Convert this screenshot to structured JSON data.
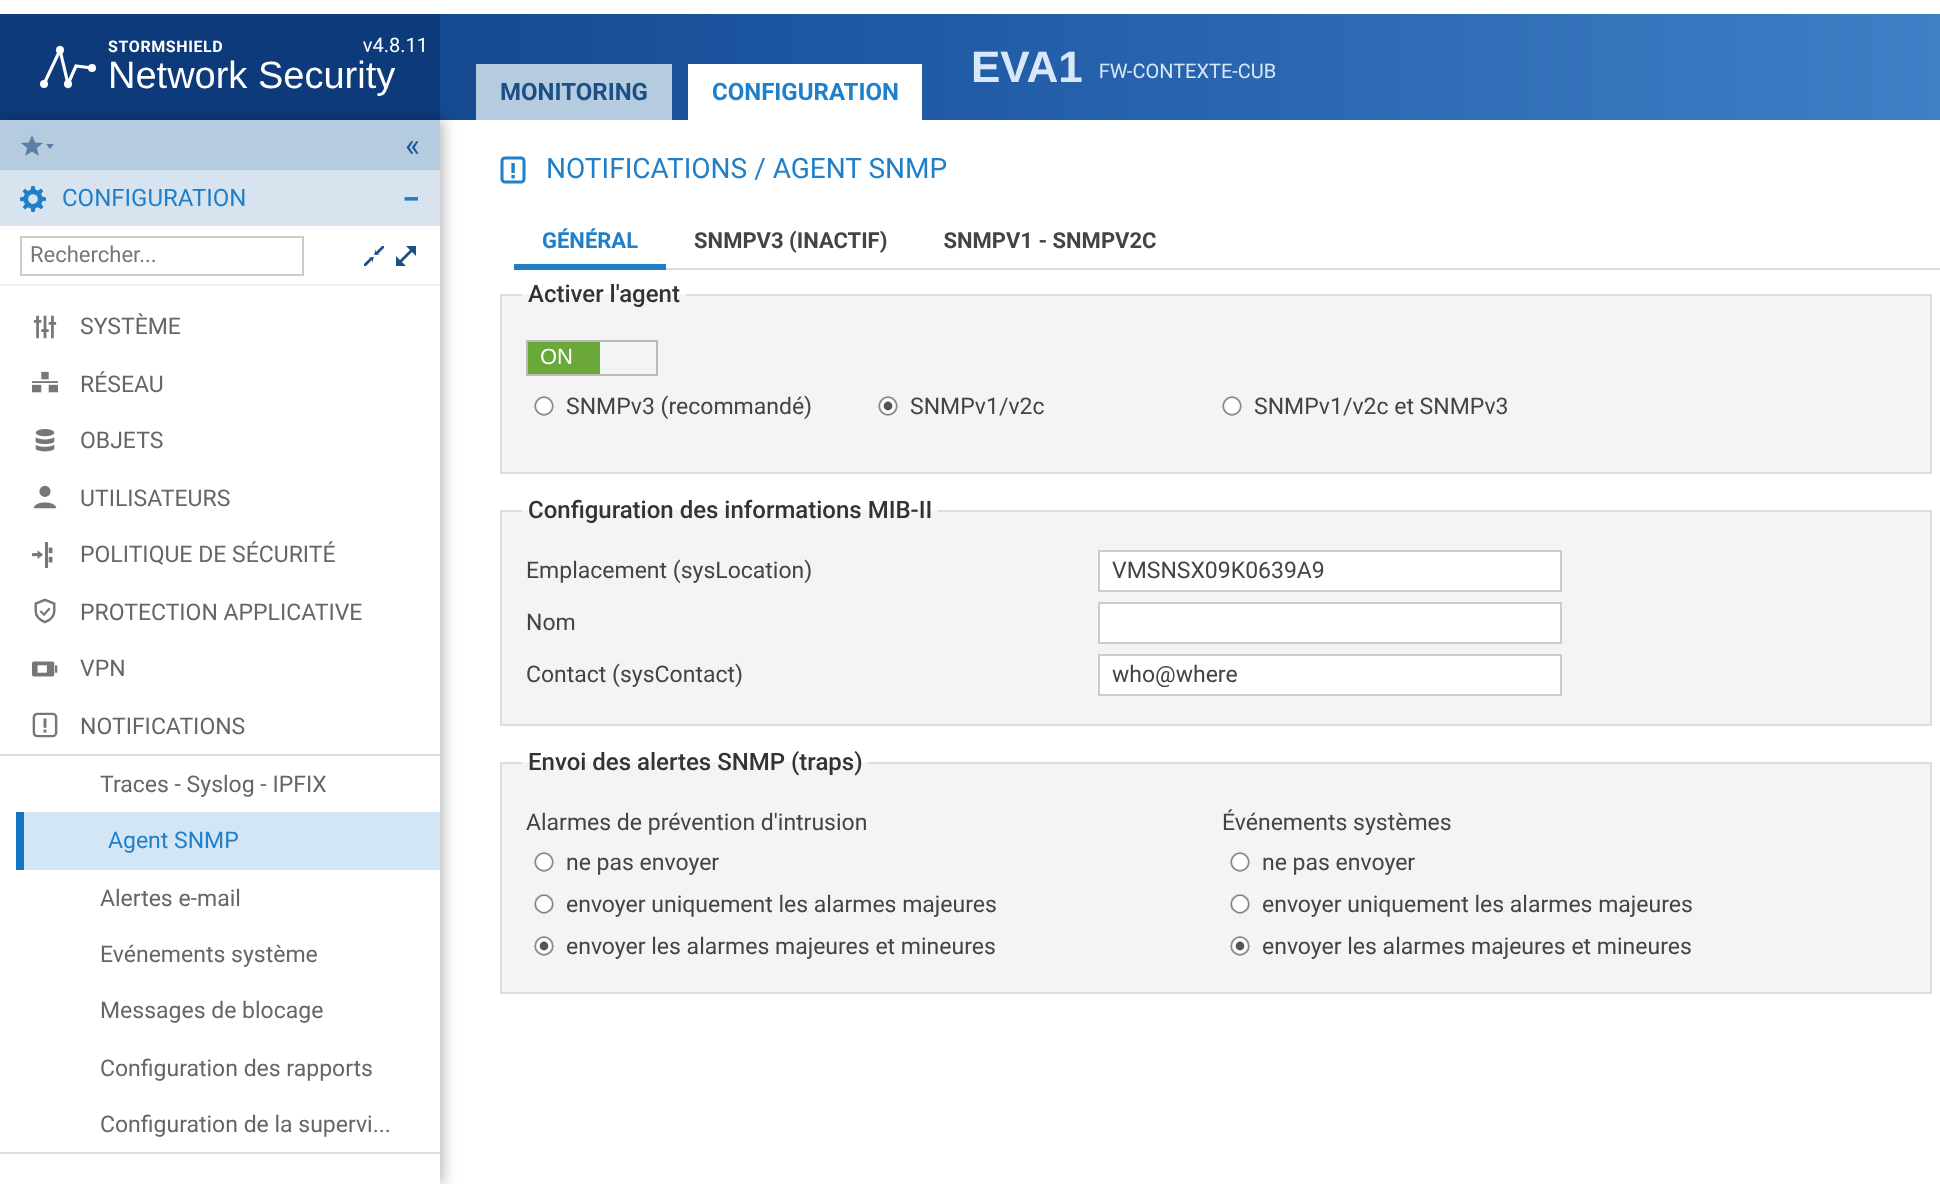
{
  "header": {
    "brand": "STORMSHIELD",
    "product": "Network Security",
    "version": "v4.8.11",
    "tabs": [
      {
        "label": "MONITORING",
        "selected": false
      },
      {
        "label": "CONFIGURATION",
        "selected": true
      }
    ],
    "device": "EVA1",
    "context": "FW-CONTEXTE-CUB"
  },
  "sidebar": {
    "section": {
      "label": "CONFIGURATION",
      "expanded": true,
      "toggle": "−"
    },
    "collapse": "«",
    "search": {
      "placeholder": "Rechercher..."
    },
    "items": [
      {
        "label": "SYSTÈME"
      },
      {
        "label": "RÉSEAU"
      },
      {
        "label": "OBJETS"
      },
      {
        "label": "UTILISATEURS"
      },
      {
        "label": "POLITIQUE DE SÉCURITÉ"
      },
      {
        "label": "PROTECTION APPLICATIVE"
      },
      {
        "label": "VPN"
      },
      {
        "label": "NOTIFICATIONS",
        "children": [
          {
            "label": "Traces - Syslog - IPFIX",
            "selected": false
          },
          {
            "label": "Agent SNMP",
            "selected": true
          },
          {
            "label": "Alertes e-mail",
            "selected": false
          },
          {
            "label": "Evénements système",
            "selected": false
          },
          {
            "label": "Messages de blocage",
            "selected": false
          },
          {
            "label": "Configuration des rapports",
            "selected": false
          },
          {
            "label": "Configuration de la supervi...",
            "selected": false
          }
        ]
      }
    ]
  },
  "main": {
    "title": "NOTIFICATIONS / AGENT SNMP",
    "tabs": [
      {
        "label": "GÉNÉRAL",
        "selected": true
      },
      {
        "label": "SNMPV3 (INACTIF)",
        "selected": false
      },
      {
        "label": "SNMPV1 - SNMPV2C",
        "selected": false
      }
    ],
    "sections": [
      {
        "kind": "agent",
        "legend": "Activer l'agent",
        "toggle": {
          "label": "ON",
          "on": true
        },
        "options": [
          {
            "label": "SNMPv3 (recommandé)",
            "selected": false
          },
          {
            "label": "SNMPv1/v2c",
            "selected": true
          },
          {
            "label": "SNMPv1/v2c et SNMPv3",
            "selected": false
          }
        ]
      },
      {
        "kind": "fields",
        "legend": "Configuration des informations MIB-II",
        "fields": [
          {
            "label": "Emplacement (sysLocation)",
            "value": "VMSNSX09K0639A9"
          },
          {
            "label": "Nom"
          },
          {
            "label": "Contact (sysContact)",
            "value": "who@where"
          }
        ]
      },
      {
        "kind": "columns",
        "legend": "Envoi des alertes SNMP (traps)",
        "columns": [
          {
            "title": "Alarmes de prévention d'intrusion",
            "options": [
              {
                "label": "ne pas envoyer",
                "selected": false
              },
              {
                "label": "envoyer uniquement les alarmes majeures",
                "selected": false
              },
              {
                "label": "envoyer les alarmes majeures et mineures",
                "selected": true
              }
            ]
          },
          {
            "title": "Événements systèmes",
            "options": [
              {
                "label": "ne pas envoyer",
                "selected": false
              },
              {
                "label": "envoyer uniquement les alarmes majeures",
                "selected": false
              },
              {
                "label": "envoyer les alarmes majeures et mineures",
                "selected": true
              }
            ]
          }
        ]
      }
    ]
  }
}
